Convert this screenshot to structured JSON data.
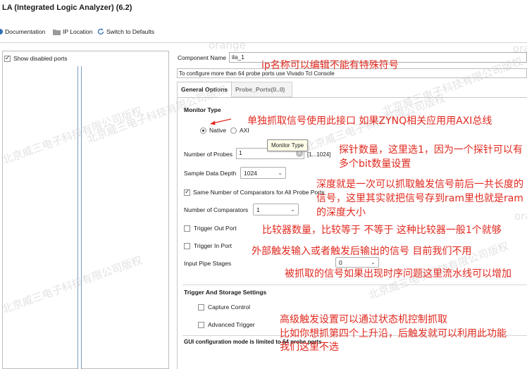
{
  "window": {
    "title": "LA (Integrated Logic Analyzer) (6.2)"
  },
  "toolbar": {
    "documentation": "Documentation",
    "ip_location": "IP Location",
    "switch_defaults": "Switch to Defaults"
  },
  "left_panel": {
    "show_disabled_ports": "Show disabled ports",
    "show_disabled_checked": true
  },
  "component": {
    "label": "Component Name",
    "value": "ila_1",
    "info": "To configure more than 64 probe ports use Vivado Tcl Console"
  },
  "tabs": [
    {
      "label": "General Options",
      "active": true
    },
    {
      "label": "Probe_Ports(0..0)",
      "active": false
    }
  ],
  "general": {
    "monitor_type": {
      "heading": "Monitor Type",
      "options": [
        {
          "label": "Native",
          "selected": true
        },
        {
          "label": "AXI",
          "selected": false
        }
      ],
      "tooltip": "Monitor Type"
    },
    "num_probes": {
      "label": "Number of Probes",
      "value": "1",
      "range": "[1...1024]"
    },
    "sample_depth": {
      "label": "Sample Data Depth",
      "value": "1024"
    },
    "same_comparators": {
      "label": "Same Number of Comparators for All Probe Ports",
      "checked": true
    },
    "num_comparators": {
      "label": "Number of Comparators",
      "value": "1"
    },
    "trigger_out": {
      "label": "Trigger Out Port",
      "checked": false
    },
    "trigger_in": {
      "label": "Trigger In Port",
      "checked": false
    },
    "pipe_stages": {
      "label": "Input Pipe Stages",
      "value": "0"
    }
  },
  "trigger_storage": {
    "heading": "Trigger And Storage Settings",
    "capture_control": "Capture Control",
    "advanced_trigger": "Advanced Trigger"
  },
  "footer_note": "GUI configuration mode is limited to 64 probe ports",
  "annotations": {
    "ip_name": "ip名称可以编辑不能有特殊符号",
    "native_port": "单独抓取信号使用此接口 如果ZYNQ相关应用用AXI总线",
    "probes_1": "探针数量，这里选1，因为一个探针可以有",
    "probes_2": "多个bit数量设置",
    "depth_1": "深度就是一次可以抓取触发信号前后一共长度的",
    "depth_2": "信号，这里其实就把信号存到ram里也就是ram",
    "depth_3": "的深度大小",
    "comparators": "比较器数量，比较等于 不等于 这种比较器一般1个就够",
    "triggers": "外部触发输入或者触发后输出的信号 目前我们不用",
    "pipe": "被抓取的信号如果出现时序问题这里流水线可以增加",
    "adv_1": "高级触发设置可以通过状态机控制抓取",
    "adv_2": "比如你想抓第四个上升沿，后触发就可以利用此功能",
    "adv_3": "我们这里不选"
  },
  "watermarks": {
    "company": "北京威三电子科技有限公司版权",
    "orange": "orange"
  },
  "colors": {
    "annotation": "#e02a20",
    "arrow": "#e02a20"
  }
}
